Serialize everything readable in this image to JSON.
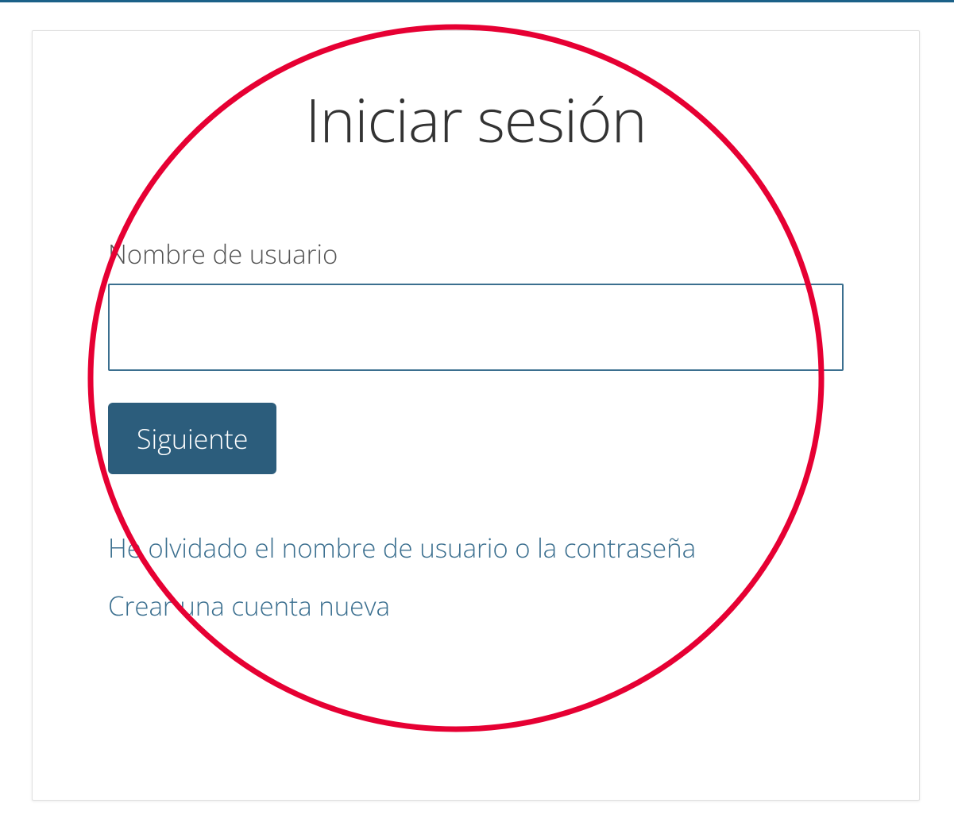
{
  "login": {
    "title": "Iniciar sesión",
    "username_label": "Nombre de usuario",
    "username_value": "",
    "next_button": "Siguiente",
    "forgot_link": "He olvidado el nombre de usuario o la contraseña",
    "create_link": "Crear una cuenta nueva"
  },
  "annotation": {
    "circle_color": "#e60033",
    "stroke_width": 6
  }
}
